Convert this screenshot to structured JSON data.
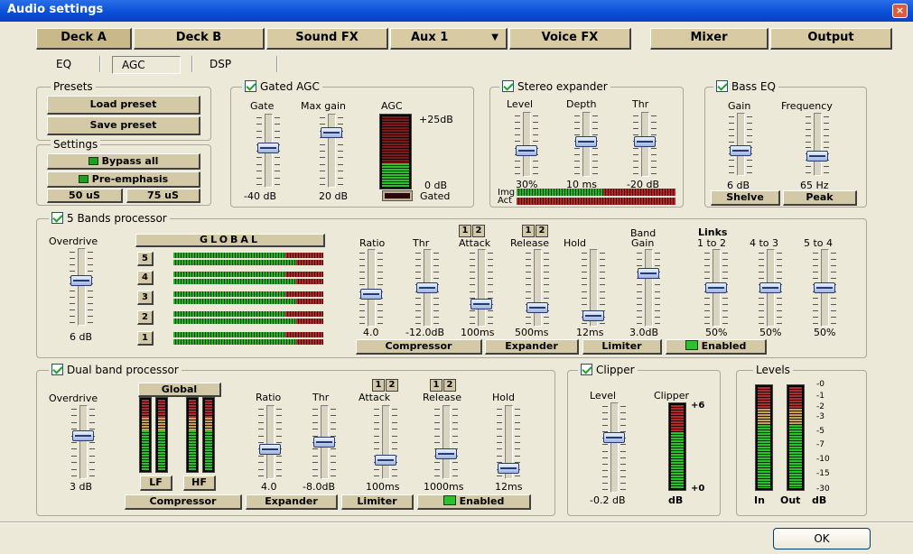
{
  "window": {
    "title": "Audio settings",
    "close": "×"
  },
  "tabs": [
    "Deck A",
    "Deck B",
    "Sound FX",
    "Aux 1",
    "▼",
    "Voice FX",
    "Mixer",
    "Output"
  ],
  "subtabs": [
    "EQ",
    "AGC",
    "DSP"
  ],
  "presets": {
    "title": "Presets",
    "load": "Load preset",
    "save": "Save preset"
  },
  "settings": {
    "title": "Settings",
    "bypass": "Bypass all",
    "preemph": "Pre-emphasis",
    "t50": "50 uS",
    "t75": "75 uS"
  },
  "gated_agc": {
    "title": "Gated AGC",
    "gate": "Gate",
    "maxgain": "Max gain",
    "agc": "AGC",
    "plus25": "+25dB",
    "zero": "0 dB",
    "gate_val": "-40 dB",
    "maxgain_val": "20 dB",
    "gated": "Gated",
    "gate_level": 0.55,
    "maxgain_level": 0.25
  },
  "stereo": {
    "title": "Stereo expander",
    "level": "Level",
    "depth": "Depth",
    "thr": "Thr",
    "level_val": "30%",
    "depth_val": "10 ms",
    "thr_val": "-20 dB",
    "img": "Img",
    "act": "Act"
  },
  "bass": {
    "title": "Bass EQ",
    "gain": "Gain",
    "freq": "Frequency",
    "gain_val": "6 dB",
    "freq_val": "65 Hz",
    "shelve": "Shelve",
    "peak": "Peak"
  },
  "five_band": {
    "title": "5 Bands processor",
    "overdrive": "Overdrive",
    "overdrive_val": "6 dB",
    "global": "GLOBAL",
    "bands": [
      "5",
      "4",
      "3",
      "2",
      "1"
    ],
    "ratio": "Ratio",
    "thr": "Thr",
    "attack": "Attack",
    "release": "Release",
    "hold": "Hold",
    "band": "Band",
    "gain": "Gain",
    "links": "Links",
    "l12": "1 to 2",
    "l43": "4 to 3",
    "l54": "5 to 4",
    "ratio_val": "4.0",
    "thr_val": "-12.0dB",
    "attack_val": "100ms",
    "release_val": "500ms",
    "hold_val": "12ms",
    "gain_val": "3.0dB",
    "l12_val": "50%",
    "l43_val": "50%",
    "l54_val": "50%",
    "sel": [
      "1",
      "2",
      "1",
      "2"
    ],
    "compressor": "Compressor",
    "expander": "Expander",
    "limiter": "Limiter",
    "enabled": "Enabled"
  },
  "dual_band": {
    "title": "Dual band processor",
    "overdrive": "Overdrive",
    "overdrive_val": "3 dB",
    "global": "Global",
    "lf": "LF",
    "hf": "HF",
    "ratio": "Ratio",
    "thr": "Thr",
    "attack": "Attack",
    "release": "Release",
    "hold": "Hold",
    "ratio_val": "4.0",
    "thr_val": "-8.0dB",
    "attack_val": "100ms",
    "release_val": "1000ms",
    "hold_val": "12ms",
    "sel": [
      "1",
      "2",
      "1",
      "2"
    ],
    "compressor": "Compressor",
    "expander": "Expander",
    "limiter": "Limiter",
    "enabled": "Enabled"
  },
  "clipper": {
    "title": "Clipper",
    "level": "Level",
    "clipper": "Clipper",
    "plus6": "+6",
    "plus0": "+0",
    "level_val": "-0.2 dB",
    "db": "dB"
  },
  "levels": {
    "title": "Levels",
    "scale": [
      "-0",
      "-1",
      "-2",
      "-3",
      "-5",
      "-7",
      "-10",
      "-15",
      "-30"
    ],
    "in": "In",
    "out": "Out",
    "db": "dB"
  },
  "ok": "OK"
}
